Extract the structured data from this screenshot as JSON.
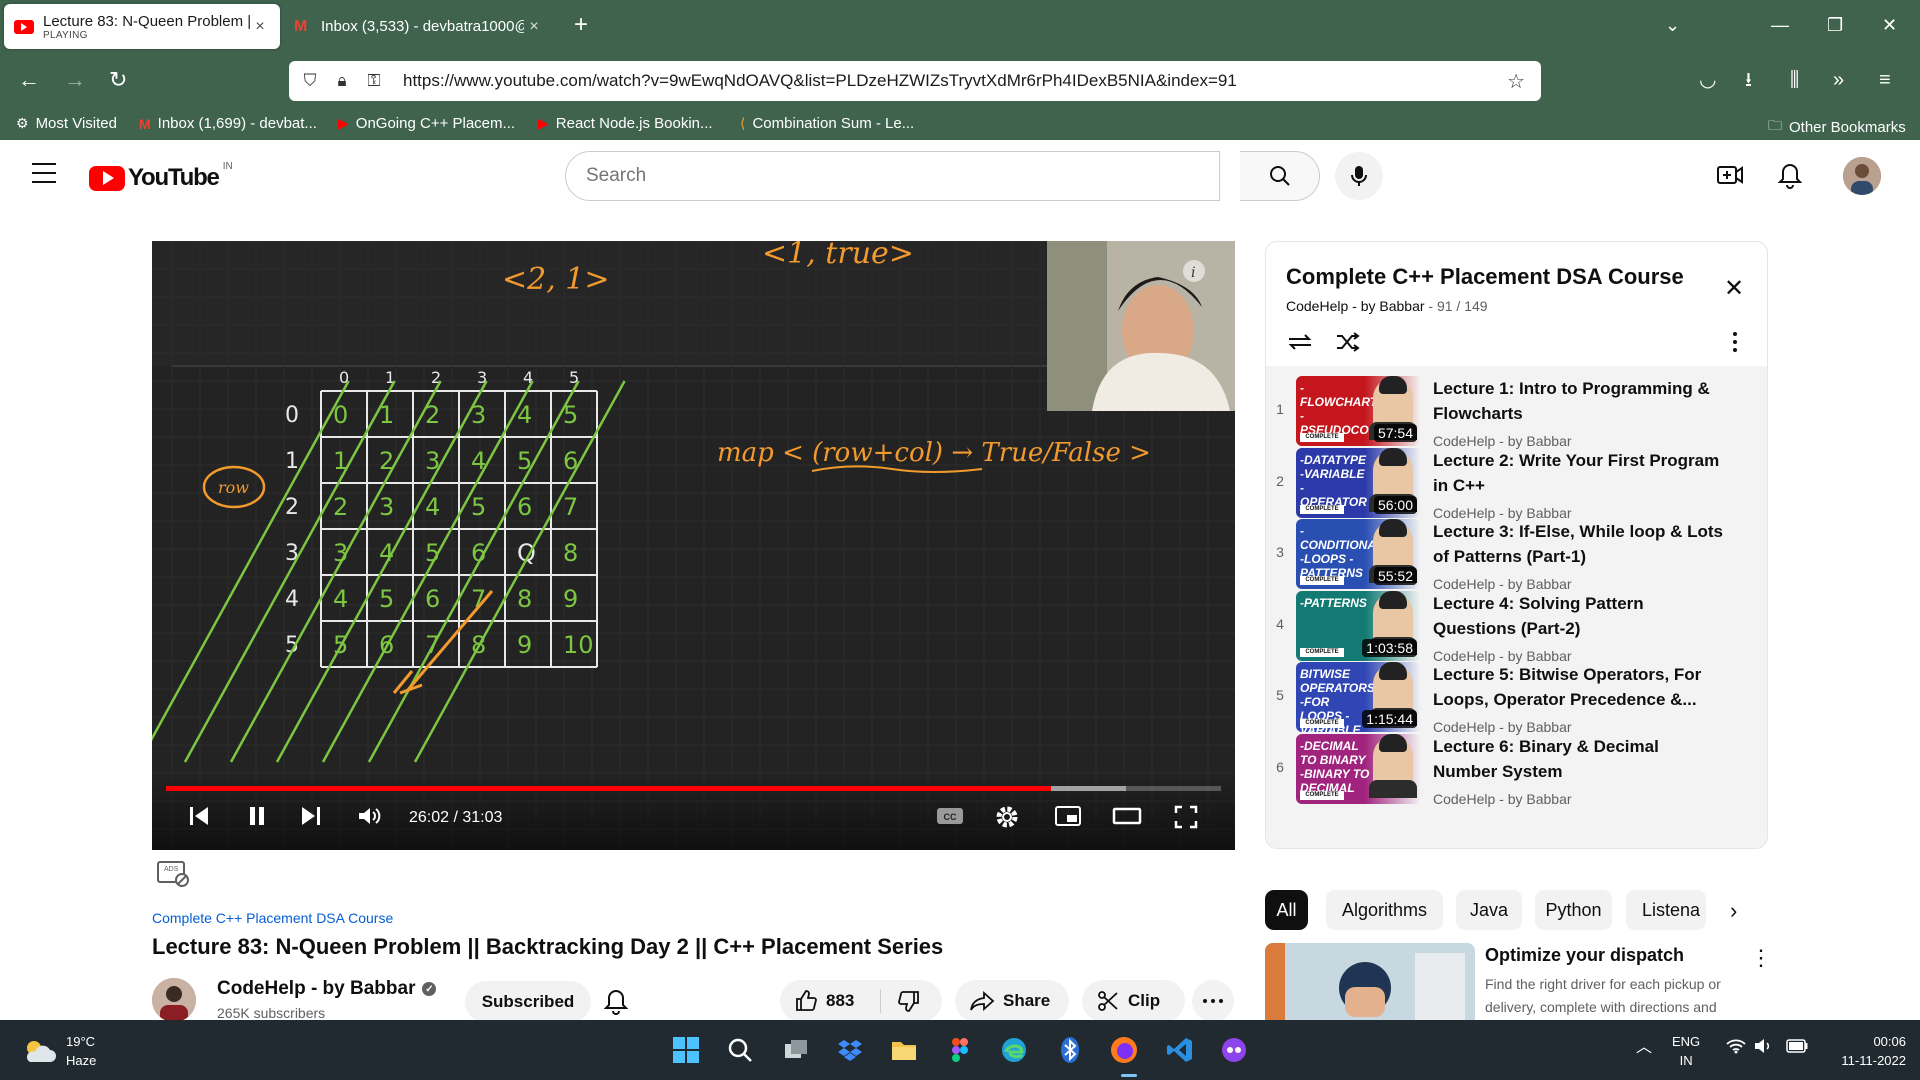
{
  "browser": {
    "tabs": [
      {
        "title": "Lecture 83: N-Queen Problem ||",
        "status": "PLAYING",
        "close": "×"
      },
      {
        "title": "Inbox (3,533) - devbatra1000@",
        "close": "×"
      }
    ],
    "new_tab": "+",
    "url": "https://www.youtube.com/watch?v=9wEwqNdOAVQ&list=PLDzeHZWIZsTryvtXdMr6rPh4IDexB5NIA&index=91",
    "bookmarks": [
      "Most Visited",
      "Inbox (1,699) - devbat...",
      "OnGoing C++ Placem...",
      "React Node.js Bookin...",
      "Combination Sum - Le..."
    ],
    "other_bookmarks": "Other Bookmarks"
  },
  "youtube": {
    "logo": "YouTube",
    "country": "IN",
    "search_placeholder": "Search"
  },
  "player": {
    "time": "26:02 / 31:03",
    "progress": 0.8386,
    "buffered": 0.91,
    "board": {
      "columns": [
        "0",
        "1",
        "2",
        "3",
        "4",
        "5"
      ],
      "rows": [
        "0",
        "1",
        "2",
        "3",
        "4",
        "5"
      ],
      "cells": [
        [
          "0",
          "1",
          "2",
          "3",
          "4",
          "5"
        ],
        [
          "1",
          "2",
          "3",
          "4",
          "5",
          "6"
        ],
        [
          "2",
          "3",
          "4",
          "5",
          "6",
          "7"
        ],
        [
          "3",
          "4",
          "5",
          "6",
          "Q",
          "8"
        ],
        [
          "4",
          "5",
          "6",
          "7",
          "8",
          "9"
        ],
        [
          "5",
          "6",
          "7",
          "8",
          "9",
          "10"
        ]
      ],
      "top_left": "<2, 1>",
      "top_right": "<1, true>",
      "map_note": "map < (row+col) → True/False >",
      "row_label": "row"
    }
  },
  "playlist": {
    "title": "Complete C++ Placement DSA Course",
    "channel": "CodeHelp - by Babbar",
    "position": " - 91 / 149",
    "items": [
      {
        "index": "1",
        "title": "Lecture 1: Intro to Programming & Flowcharts",
        "channel": "CodeHelp - by Babbar",
        "duration": "57:54",
        "thumb_text": "-FLOWCHART -PSEUDOCODE",
        "thumb_color": "#c4161c"
      },
      {
        "index": "2",
        "title": "Lecture 2: Write Your First Program in C++",
        "channel": "CodeHelp - by Babbar",
        "duration": "56:00",
        "thumb_text": "-DATATYPE -VARIABLE -OPERATOR",
        "thumb_color": "#2b3aa8"
      },
      {
        "index": "3",
        "title": "Lecture 3: If-Else, While loop & Lots of Patterns (Part-1)",
        "channel": "CodeHelp - by Babbar",
        "duration": "55:52",
        "thumb_text": "-CONDITIONALS -LOOPS -PATTERNS",
        "thumb_color": "#2a4fb3"
      },
      {
        "index": "4",
        "title": "Lecture 4: Solving Pattern Questions (Part-2)",
        "channel": "CodeHelp - by Babbar",
        "duration": "1:03:58",
        "thumb_text": "-PATTERNS",
        "thumb_color": "#137a73"
      },
      {
        "index": "5",
        "title": "Lecture 5: Bitwise Operators, For Loops, Operator Precedence &...",
        "channel": "CodeHelp - by Babbar",
        "duration": "1:15:44",
        "thumb_text": "BITWISE OPERATORS -FOR LOOPS -VARIABLE SCOPING",
        "thumb_color": "#3046b5"
      },
      {
        "index": "6",
        "title": "Lecture 6: Binary & Decimal Number System",
        "channel": "CodeHelp - by Babbar",
        "duration": "",
        "thumb_text": "-DECIMAL TO BINARY -BINARY TO DECIMAL",
        "thumb_color": "#a0237d"
      }
    ]
  },
  "video": {
    "playlist_link": "Complete C++ Placement DSA Course",
    "title": "Lecture 83: N-Queen Problem || Backtracking Day 2 || C++ Placement Series",
    "channel": "CodeHelp - by Babbar",
    "subscribers": "265K subscribers",
    "subscribe_label": "Subscribed",
    "likes": "883",
    "share": "Share",
    "clip": "Clip"
  },
  "chips": [
    "All",
    "Algorithms",
    "Java",
    "Python",
    "Listena"
  ],
  "ad": {
    "title": "Optimize your dispatch",
    "description": "Find the right driver for each pickup or delivery, complete with directions and"
  },
  "taskbar": {
    "temperature": "19°C",
    "weather": "Haze",
    "lang1": "ENG",
    "lang2": "IN",
    "time": "00:06",
    "date": "11-11-2022"
  },
  "colors": {
    "chrome": "#3f634d",
    "accent_red": "#ff0000",
    "link_blue": "#065fd4",
    "board_green": "#7cc642",
    "board_orange": "#f29a2e"
  }
}
